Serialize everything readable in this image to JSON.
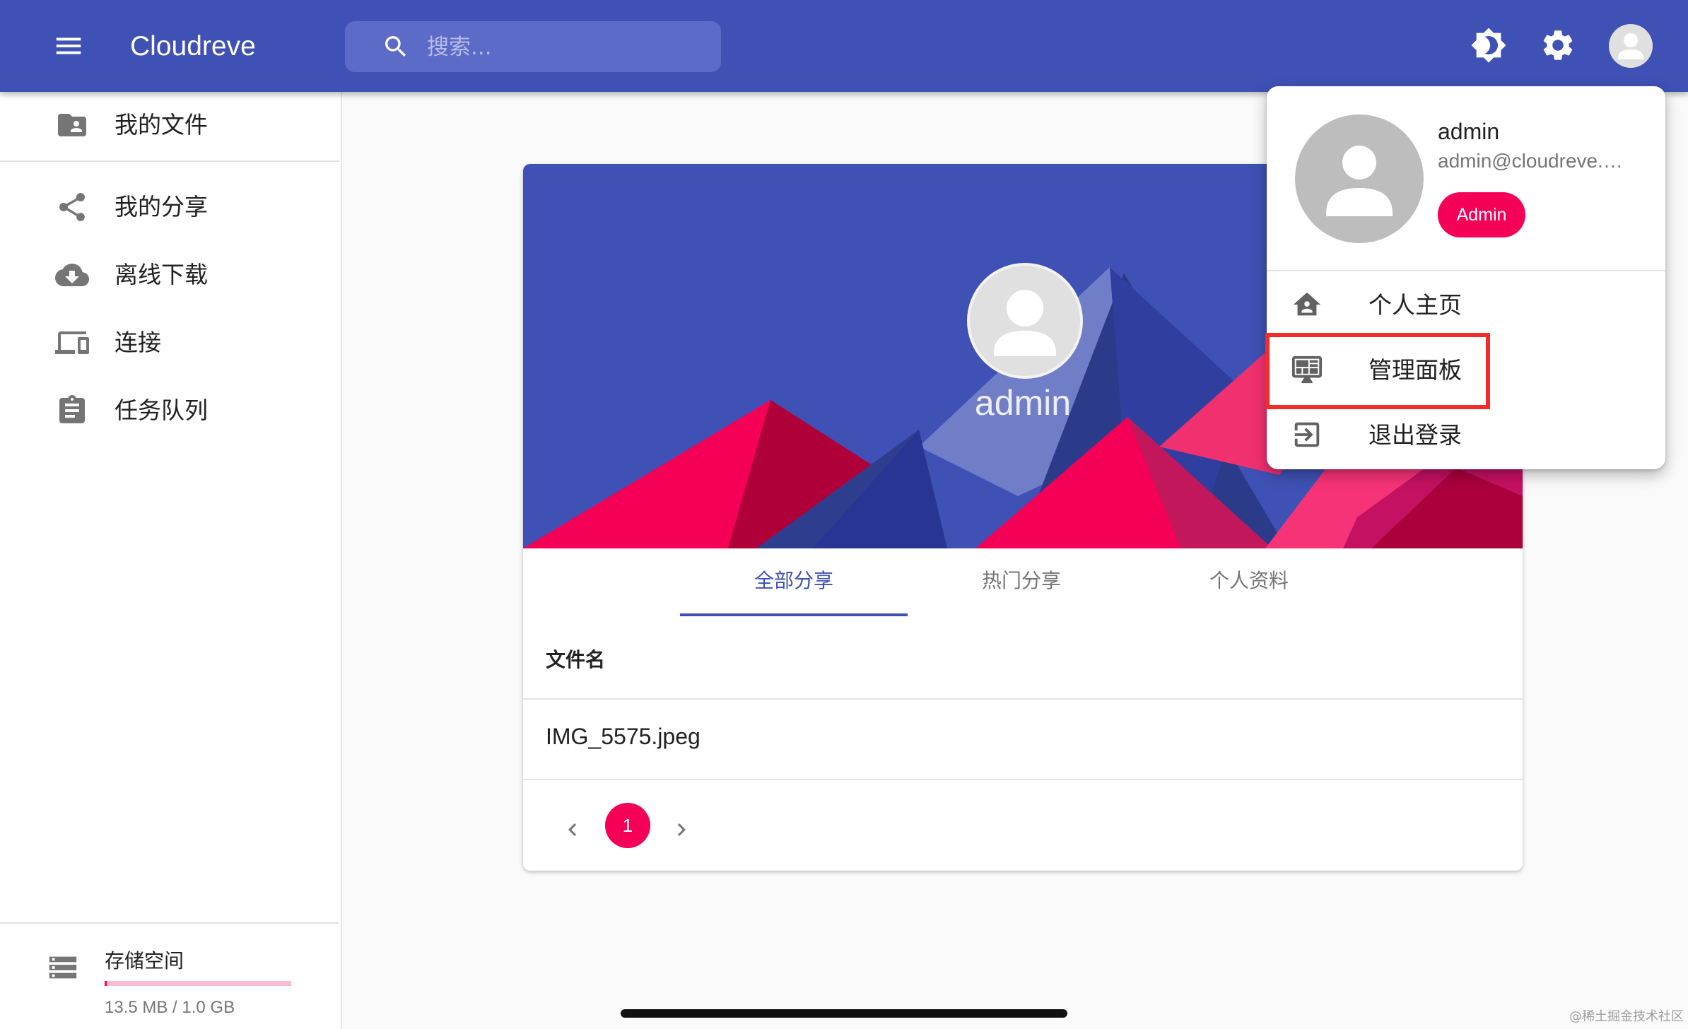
{
  "app": {
    "title": "Cloudreve"
  },
  "search": {
    "placeholder": "搜索..."
  },
  "header_icons": [
    "menu-icon",
    "search-icon",
    "theme-toggle-icon",
    "gear-icon",
    "account-circle-icon"
  ],
  "sidebar": {
    "items": [
      {
        "label": "我的文件",
        "icon": "folder-account-icon"
      },
      {
        "label": "我的分享",
        "icon": "share-icon"
      },
      {
        "label": "离线下载",
        "icon": "cloud-download-icon"
      },
      {
        "label": "连接",
        "icon": "devices-icon"
      },
      {
        "label": "任务队列",
        "icon": "clipboard-list-icon"
      }
    ],
    "storage": {
      "title": "存储空间",
      "usage_text": "13.5 MB / 1.0 GB",
      "used_fraction": 0.013,
      "icon": "storage-icon"
    }
  },
  "profile": {
    "name": "admin",
    "tabs": [
      {
        "label": "全部分享",
        "active": true
      },
      {
        "label": "热门分享",
        "active": false
      },
      {
        "label": "个人资料",
        "active": false
      }
    ],
    "table": {
      "column_header": "文件名",
      "rows": [
        {
          "name": "IMG_5575.jpeg"
        }
      ]
    },
    "pagination": {
      "current_page": "1"
    }
  },
  "user_menu": {
    "username": "admin",
    "email": "admin@cloudreve.…",
    "role_badge": "Admin",
    "items": [
      {
        "label": "个人主页",
        "icon": "account-home-icon"
      },
      {
        "label": "管理面板",
        "icon": "monitor-dashboard-icon",
        "highlighted": true
      },
      {
        "label": "退出登录",
        "icon": "logout-icon"
      }
    ]
  },
  "watermark": "@稀土掘金技术社区",
  "colors": {
    "primary": "#3f51b5",
    "secondary": "#f50057",
    "highlight_outline": "#f52b2b"
  }
}
